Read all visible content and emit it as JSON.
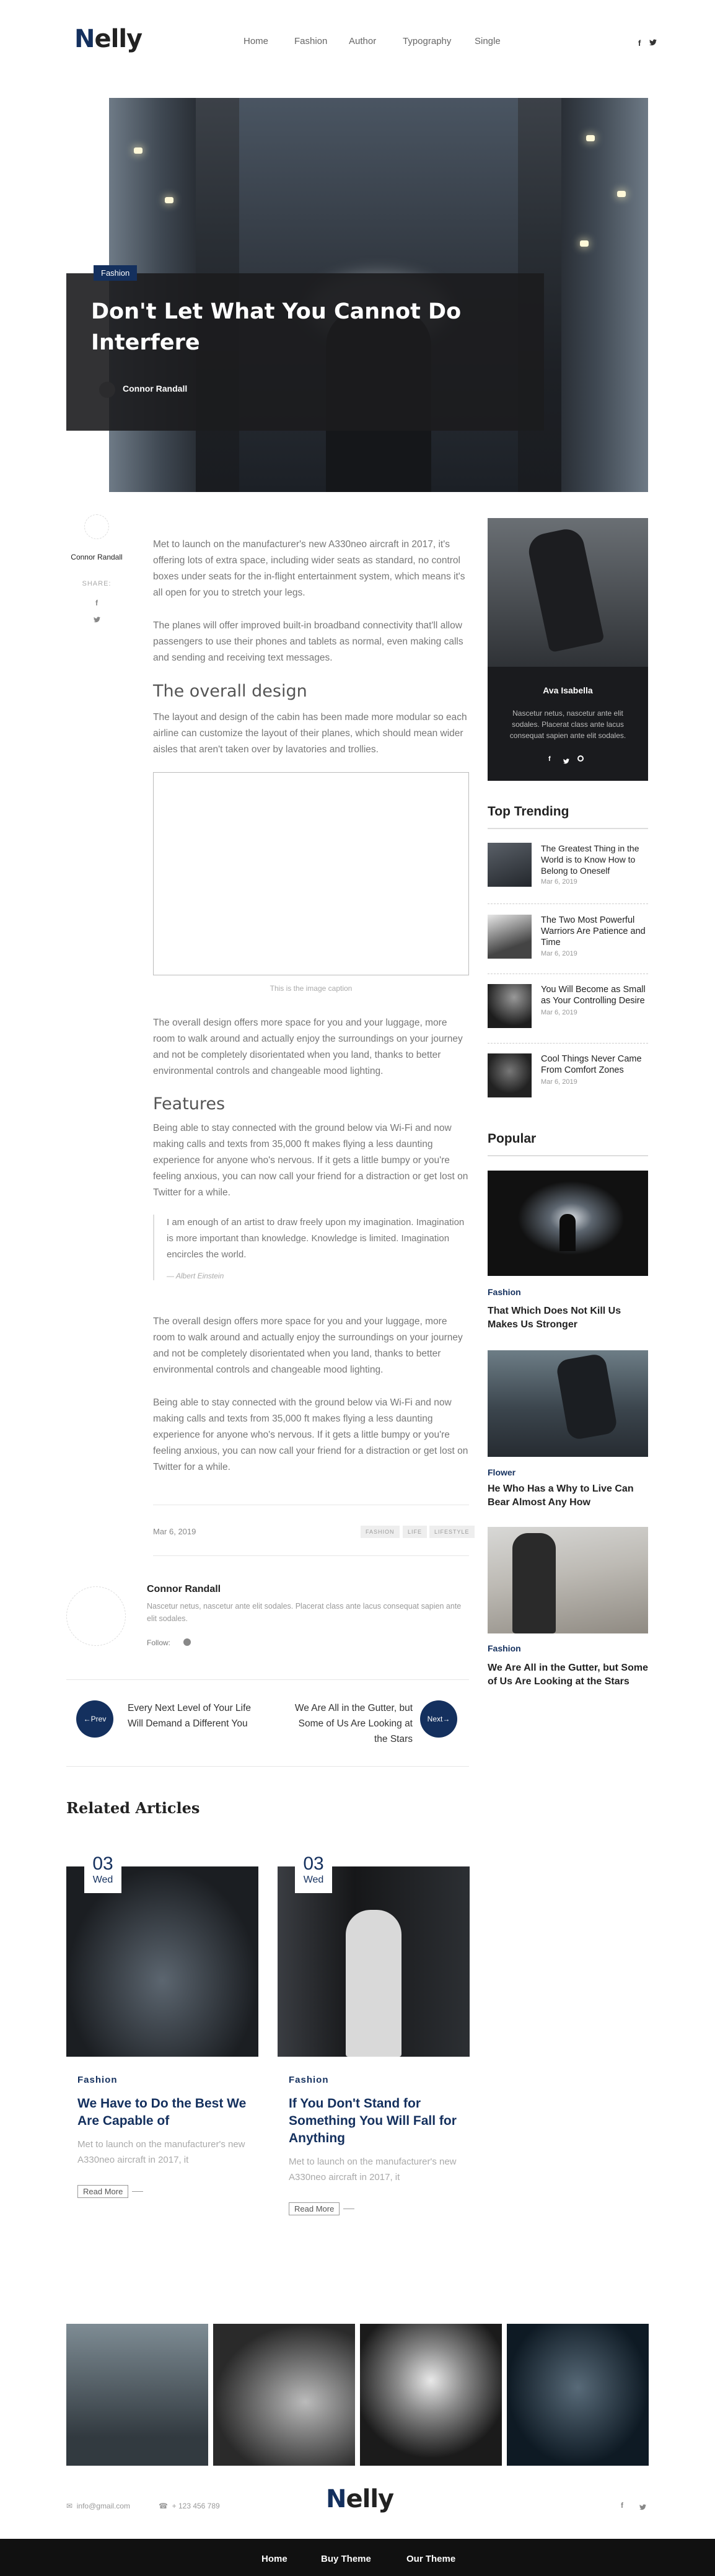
{
  "header": {
    "logo": "Nelly",
    "nav": [
      "Home",
      "Fashion",
      "Author",
      "Typography",
      "Single"
    ],
    "social": {
      "facebook": "f",
      "twitter": "t"
    }
  },
  "hero": {
    "category": "Fashion",
    "title": "Don't Let What You Cannot Do Interfere",
    "author": "Connor Randall"
  },
  "share": {
    "author": "Connor Randall",
    "label": "SHARE:"
  },
  "article": {
    "p1": "Met to launch on the manufacturer's new A330neo aircraft in 2017, it's offering lots of extra space, including wider seats as standard, no control boxes under seats for the in-flight entertainment system, which means it's all open for you to stretch your legs.",
    "p2": "The planes will offer improved built-in broadband connectivity that'll allow passengers to use their phones and tablets as normal, even making calls and sending and receiving text messages.",
    "h_design": "The overall design",
    "p3": "The layout and design of the cabin has been made more modular so each airline can customize the layout of their planes, which should mean wider aisles that aren't taken over by lavatories and trollies.",
    "caption": "This is the image caption",
    "p4": "The overall design offers more space for you and your luggage, more room to walk around and actually enjoy the surroundings on your journey and not be completely disorientated when you land, thanks to better environmental controls and changeable mood lighting.",
    "h_features": "Features",
    "p5": "Being able to stay connected with the ground below via Wi-Fi and now making calls and texts from 35,000 ft makes flying a less daunting experience for anyone who's nervous. If it gets a little bumpy or you're feeling anxious, you can now call your friend for a distraction or get lost on Twitter for a while.",
    "quote": "I am enough of an artist to draw freely upon my imagination. Imagination is more important than knowledge. Knowledge is limited. Imagination encircles the world.",
    "quote_author": "— Albert Einstein",
    "p6": "The overall design offers more space for you and your luggage, more room to walk around and actually enjoy the surroundings on your journey and not be completely disorientated when you land, thanks to better environmental controls and changeable mood lighting.",
    "p7": "Being able to stay connected with the ground below via Wi-Fi and now making calls and texts from 35,000 ft makes flying a less daunting experience for anyone who's nervous. If it gets a little bumpy or you're feeling anxious, you can now call your friend for a distraction or get lost on Twitter for a while.",
    "date": "Mar 6, 2019",
    "tags": [
      "FASHION",
      "LIFE",
      "LIFESTYLE"
    ]
  },
  "author_box": {
    "name": "Connor Randall",
    "bio": "Nascetur netus, nascetur ante elit sodales. Placerat class ante lacus consequat sapien ante elit sodales.",
    "follow": "Follow:"
  },
  "post_nav": {
    "prev_label": "Prev",
    "prev_title": "Every Next Level of Your Life Will Demand a Different You",
    "next_label": "Next",
    "next_title": "We Are All in the Gutter, but Some of Us Are Looking at the Stars"
  },
  "sidebar": {
    "profile_name": "Ava Isabella",
    "profile_bio": "Nascetur netus, nascetur ante elit sodales. Placerat class ante lacus consequat sapien ante elit sodales.",
    "trending_title": "Top Trending",
    "trending": [
      {
        "title": "The Greatest Thing in the World is to Know How to Belong to Oneself",
        "date": "Mar 6, 2019"
      },
      {
        "title": "The Two Most Powerful Warriors Are Patience and Time",
        "date": "Mar 6, 2019"
      },
      {
        "title": "You Will Become as Small as Your Controlling Desire",
        "date": "Mar 6, 2019"
      },
      {
        "title": "Cool Things Never Came From Comfort Zones",
        "date": "Mar 6, 2019"
      }
    ],
    "popular_title": "Popular",
    "popular": [
      {
        "category": "Fashion",
        "title": "That Which Does Not Kill Us Makes Us Stronger"
      },
      {
        "category": "Flower",
        "title": "He Who Has a Why to Live Can Bear Almost Any How"
      },
      {
        "category": "Fashion",
        "title": "We Are All in the Gutter, but Some of Us Are Looking at the Stars"
      }
    ]
  },
  "related": {
    "title": "Related Articles",
    "items": [
      {
        "day": "03",
        "weekday": "Wed",
        "category": "Fashion",
        "title": "We Have to Do the Best We Are Capable of",
        "excerpt": "Met to launch on the manufacturer's new A330neo aircraft in 2017, it",
        "read_more": "Read More"
      },
      {
        "day": "03",
        "weekday": "Wed",
        "category": "Fashion",
        "title": "If You Don't Stand for Something You Will Fall for Anything",
        "excerpt": "Met to launch on the manufacturer's new A330neo aircraft in 2017, it",
        "read_more": "Read More"
      }
    ]
  },
  "footer": {
    "email": "info@gmail.com",
    "phone": "+ 123 456 789",
    "logo": "Nelly",
    "nav": [
      "Home",
      "Buy Theme",
      "Our Theme"
    ],
    "colors": {
      "accent": "#14305e",
      "footer_bg": "#111111"
    }
  }
}
